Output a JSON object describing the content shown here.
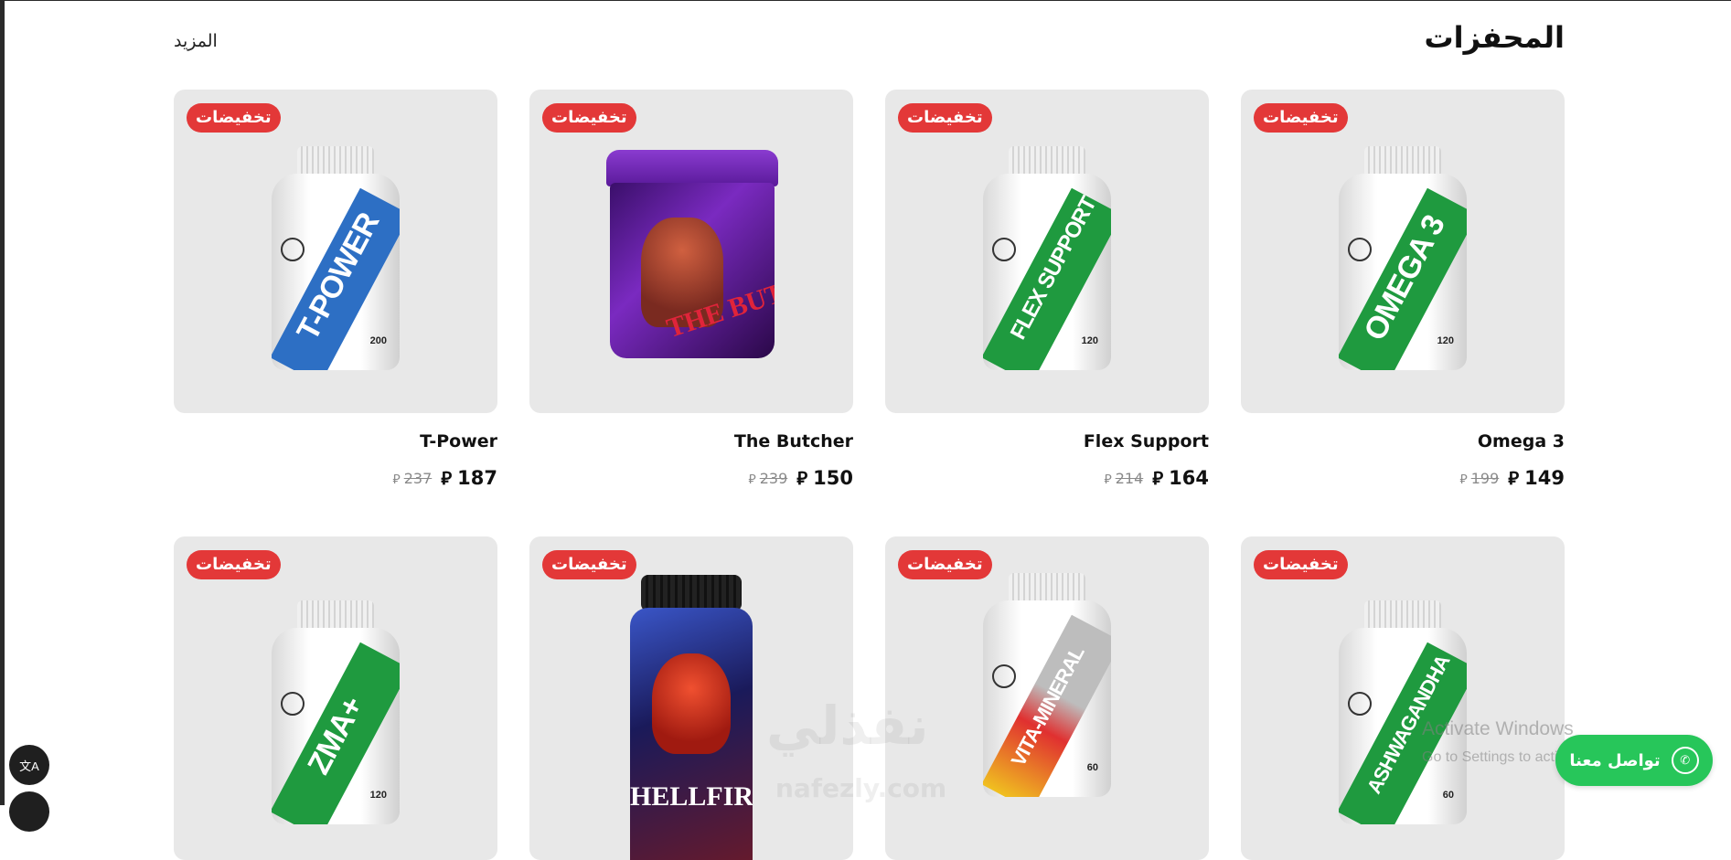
{
  "section": {
    "title": "المحفزات",
    "more_label": "المزيد"
  },
  "currency_symbol": "⃁",
  "sale_badge": "تخفيضات",
  "products_row1": [
    {
      "name": "Omega 3",
      "price": "149",
      "old_price": "199",
      "stripe_text": "OMEGA 3",
      "caps": "120",
      "stripe_color": "#1f9a3f"
    },
    {
      "name": "Flex Support",
      "price": "164",
      "old_price": "214",
      "stripe_text": "FLEX SUPPORT",
      "caps": "120",
      "stripe_color": "#1f9a3f"
    },
    {
      "name": "The Butcher",
      "price": "150",
      "old_price": "239",
      "jar_text": "THE BUTCHER"
    },
    {
      "name": "T-Power",
      "price": "187",
      "old_price": "237",
      "stripe_text": "T-POWER",
      "caps": "200",
      "stripe_color": "#2d6fc4"
    }
  ],
  "products_row2": [
    {
      "stripe_text": "ASHWAGANDHA",
      "caps": "60",
      "stripe_color": "#1f9a3f"
    },
    {
      "stripe_text": "VITA-MINERAL",
      "caps": "60",
      "stripe_color": "#bdbdbd"
    },
    {
      "label_text": "HELLFIRE"
    },
    {
      "stripe_text": "ZMA+",
      "caps": "120",
      "stripe_color": "#1f9a3f"
    }
  ],
  "chat": {
    "label": "تواصل معنا"
  },
  "translate": {
    "label": "文A"
  },
  "overlay": {
    "watermark": "نفذلي",
    "watermark_sub": "nafezly.com",
    "activate_title": "Activate Windows",
    "activate_sub": "Go to Settings to activate Windows."
  },
  "colors": {
    "sale_red": "#e33838",
    "whatsapp_green": "#27c65a",
    "card_bg": "#e8e8e8"
  }
}
